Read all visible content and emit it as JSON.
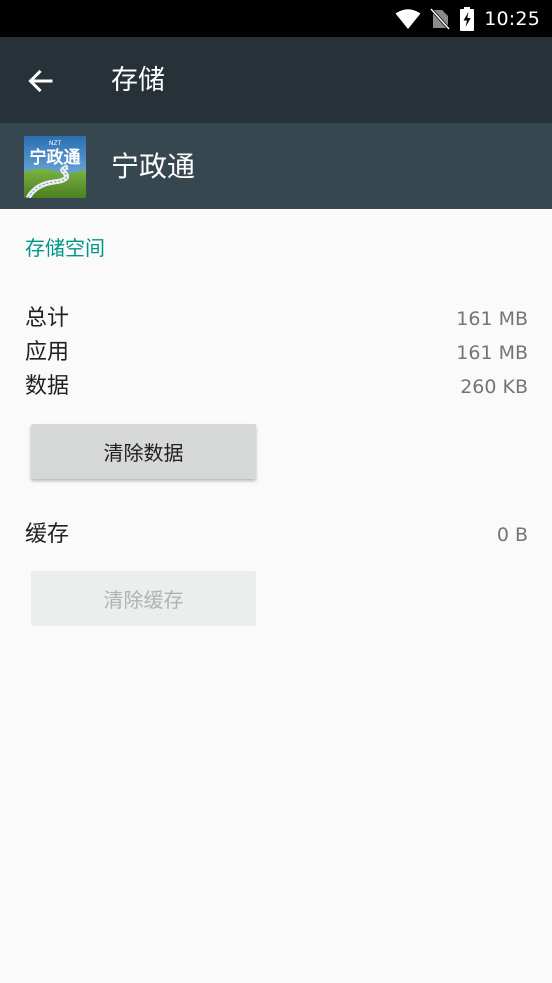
{
  "status_bar": {
    "time": "10:25",
    "icons": [
      "wifi-icon",
      "no-sim-icon",
      "battery-charging-icon"
    ]
  },
  "toolbar": {
    "back_icon": "arrow-back-icon",
    "title": "存储"
  },
  "app_header": {
    "icon_text": "宁政通",
    "icon_small_text": "NZT",
    "name": "宁政通"
  },
  "storage": {
    "section_title": "存储空间",
    "rows": [
      {
        "label": "总计",
        "value": "161 MB"
      },
      {
        "label": "应用",
        "value": "161 MB"
      },
      {
        "label": "数据",
        "value": "260 KB"
      }
    ],
    "clear_data_label": "清除数据",
    "cache_label": "缓存",
    "cache_value": "0 B",
    "clear_cache_label": "清除缓存"
  },
  "colors": {
    "status_bar": "#000000",
    "toolbar": "#263238",
    "app_header": "#37474f",
    "accent": "#009688",
    "background": "#fafafa"
  }
}
